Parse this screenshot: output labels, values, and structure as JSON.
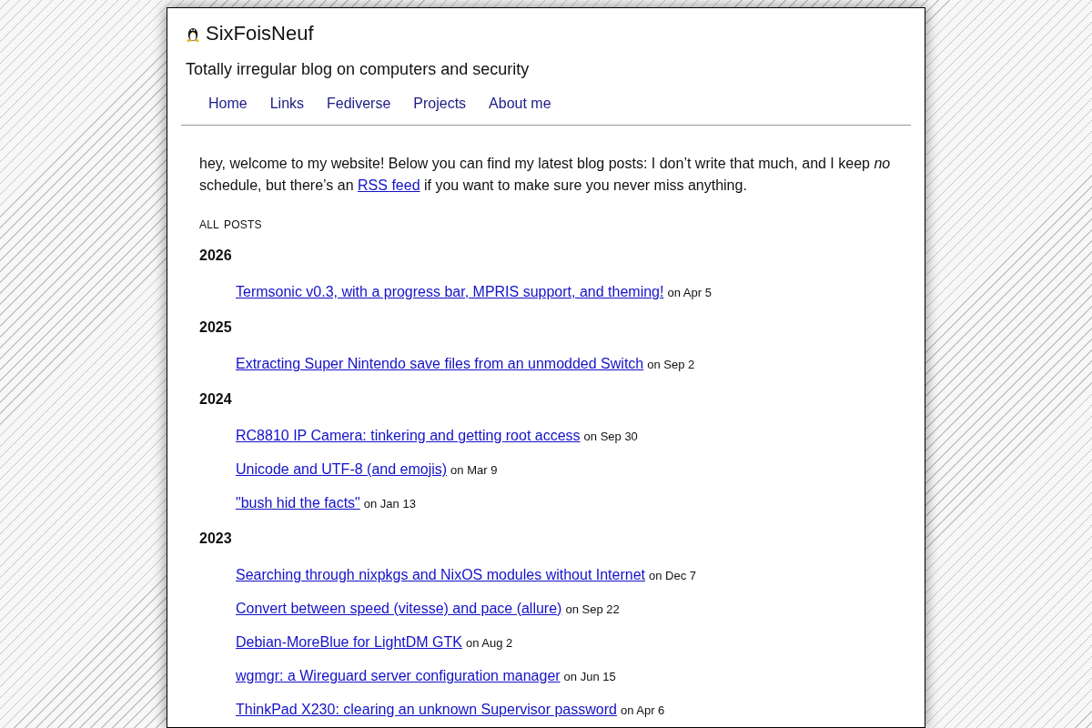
{
  "site": {
    "title": "SixFoisNeuf",
    "tagline": "Totally irregular blog on computers and security"
  },
  "nav": [
    "Home",
    "Links",
    "Fediverse",
    "Projects",
    "About me"
  ],
  "intro": {
    "before": "hey, welcome to my website! Below you can find my latest blog posts: I don’t write that much, and I keep *no* schedule, but there’s an",
    "link": "RSS feed",
    "after": "if you want to make sure you never miss anything."
  },
  "posts_heading": "ALL POSTS",
  "years": [
    {
      "year": "2026",
      "posts": [
        {
          "title": "Termsonic v0.3, with a progress bar, MPRIS support, and theming!",
          "date": "on Apr 5"
        }
      ]
    },
    {
      "year": "2025",
      "posts": [
        {
          "title": "Extracting Super Nintendo save files from an unmodded Switch",
          "date": "on Sep 2"
        }
      ]
    },
    {
      "year": "2024",
      "posts": [
        {
          "title": "RC8810 IP Camera: tinkering and getting root access",
          "date": "on Sep 30"
        },
        {
          "title": "Unicode and UTF-8 (and emojis)",
          "date": "on Mar 9"
        },
        {
          "title": "\"bush hid the facts\"",
          "date": "on Jan 13"
        }
      ]
    },
    {
      "year": "2023",
      "posts": [
        {
          "title": "Searching through nixpkgs and NixOS modules without Internet",
          "date": "on Dec 7"
        },
        {
          "title": "Convert between speed (vitesse) and pace (allure)",
          "date": "on Sep 22"
        },
        {
          "title": "Debian-MoreBlue for LightDM GTK",
          "date": "on Aug 2"
        },
        {
          "title": "wgmgr: a Wireguard server configuration manager",
          "date": "on Jun 15"
        },
        {
          "title": "ThinkPad X230: clearing an unknown Supervisor password",
          "date": "on Apr 6"
        }
      ]
    }
  ]
}
